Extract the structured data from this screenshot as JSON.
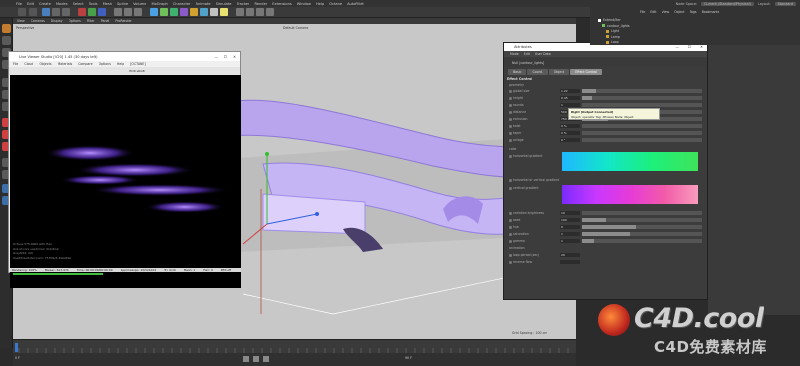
{
  "menubar": {
    "items": [
      "File",
      "Edit",
      "Create",
      "Modes",
      "Select",
      "Tools",
      "Mesh",
      "Spline",
      "Volume",
      "MoGraph",
      "Character",
      "Animate",
      "Simulate",
      "Tracker",
      "Render",
      "Extensions",
      "Window",
      "Help",
      "Octane",
      "AutoFillet"
    ],
    "node_space_label": "Node Space:",
    "node_space_value": "Current (Standard/Physical)",
    "layout_label": "Layout:",
    "layout_value": "Standard"
  },
  "viewport": {
    "menu": [
      "View",
      "Cameras",
      "Display",
      "Options",
      "Filter",
      "Panel",
      "ProRender"
    ],
    "title": "Perspective",
    "camera": "Default Camera",
    "grid_info": "Grid Spacing : 100 cm"
  },
  "render_window": {
    "title": "Live Viewer Studio [V20] 1.45 (30 days left)",
    "menu": [
      "File",
      "Cloud",
      "Objects",
      "Materials",
      "Compare",
      "Options",
      "Help",
      "[OCTANE]"
    ],
    "toolbar_mode": "HDR sRGB",
    "stats": [
      "Octane 575.0000 with Hair",
      "Out-of-core used/max: 0kb/4Gb",
      "Grey8/16: 0/0",
      "Used/free/total vram: 757Mb/5.4Gb/8Gb"
    ],
    "status_items": [
      "Rendering: 100%",
      "Ms/sec: 613.974",
      "Time: 00:00:00/00:00:00",
      "Spp/maxspp: 1024/1024",
      "Tri: 0/1K",
      "Mesh: 1",
      "Hair: 0",
      "RTX:off"
    ]
  },
  "attributes": {
    "title": "Attributes",
    "menu": [
      "Mode",
      "Edit",
      "User Data"
    ],
    "object_label": "Null [contour_lights]",
    "tabs": [
      "Basic",
      "Coord.",
      "Object",
      "Effect Control"
    ],
    "active_tab": "Effect Control",
    "section": "Effect Control",
    "groups": {
      "geometry": "geometry",
      "color": "color",
      "animation": "animation"
    },
    "rows": [
      {
        "label": "global size",
        "value": "1.22",
        "fill": 0.12
      },
      {
        "label": "height",
        "value": "0.45",
        "fill": 0.08
      },
      {
        "label": "rounds",
        "value": "1",
        "fill": 0.0
      },
      {
        "label": "distance",
        "value": "500",
        "fill": 0.3
      },
      {
        "label": "extrusion",
        "value": "750 °",
        "fill": 0.22
      },
      {
        "label": "twist",
        "value": "0 %",
        "fill": 0.0
      },
      {
        "label": "taper",
        "value": "0 %",
        "fill": 0.0
      },
      {
        "label": "anlage",
        "value": "0 °",
        "fill": 0.0
      }
    ],
    "color_rows": [
      {
        "label": "horizontal gradient"
      },
      {
        "label": "horizontal or vertical gradient"
      },
      {
        "label": "vertical gradient"
      }
    ],
    "lower_rows": [
      {
        "label": "variation brightness",
        "value": "10",
        "fill": 0.0
      },
      {
        "label": "seed",
        "value": "100",
        "fill": 0.2
      },
      {
        "label": "hue",
        "value": "0",
        "fill": 0.45
      },
      {
        "label": "saturation",
        "value": "1",
        "fill": 0.4
      },
      {
        "label": "gamma",
        "value": "1",
        "fill": 0.1
      }
    ],
    "anim_rows": [
      {
        "label": "loop period (sec)",
        "value": "20"
      },
      {
        "label": "reverse flow",
        "value": ""
      }
    ],
    "tooltip_line1": "Right [Output Connected]",
    "tooltip_line2": "Object: operator Tag: XPresso Node: Object"
  },
  "object_manager": {
    "menu": [
      "File",
      "Edit",
      "View",
      "Object",
      "Tags",
      "Bookmarks"
    ],
    "items": [
      "Extend/lter",
      "contour_lights",
      "Light",
      "Lamp",
      "Loop"
    ]
  },
  "timeline": {
    "current_frame": "0 F",
    "end_frame": "90 F"
  },
  "watermark": {
    "title": "C4D.cool",
    "subtitle": "C4D免费素材库"
  }
}
